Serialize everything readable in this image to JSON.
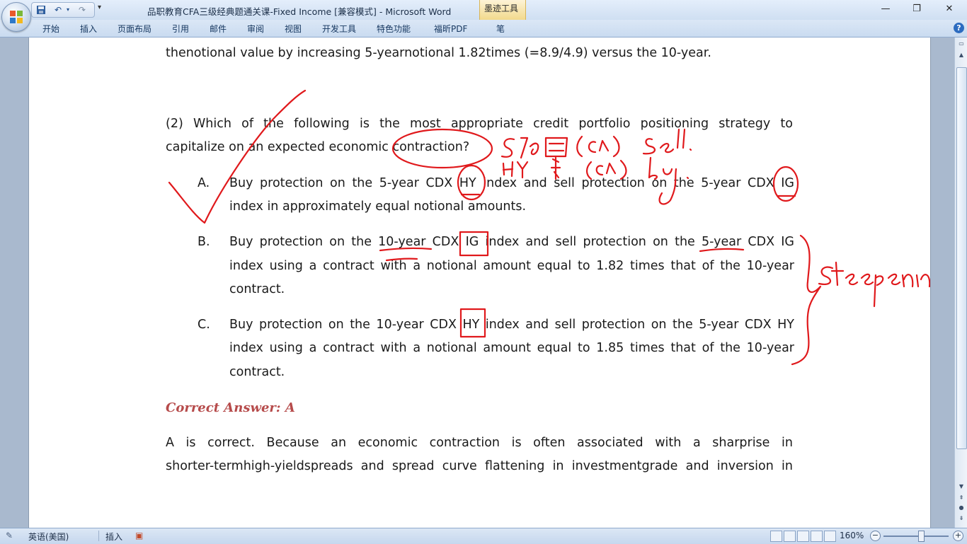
{
  "window": {
    "title": "品职教育CFA三级经典题通关课-Fixed Income [兼容模式] - Microsoft Word",
    "contextual_tab": "墨迹工具",
    "controls": {
      "minimize": "—",
      "restore": "❐",
      "close": "✕"
    }
  },
  "quick_access": {
    "save_icon": "floppy-disk",
    "undo_icon": "undo-arrow",
    "redo_icon": "redo-arrow",
    "more": "▾"
  },
  "ribbon": {
    "tabs": [
      {
        "label": "开始"
      },
      {
        "label": "插入"
      },
      {
        "label": "页面布局"
      },
      {
        "label": "引用"
      },
      {
        "label": "邮件"
      },
      {
        "label": "审阅"
      },
      {
        "label": "视图"
      },
      {
        "label": "开发工具"
      },
      {
        "label": "特色功能"
      },
      {
        "label": "福昕PDF"
      },
      {
        "label": "笔"
      }
    ],
    "help": "?"
  },
  "document": {
    "top_line": "thenotional value by increasing 5-yearnotional 1.82times (=8.9/4.9) versus the 10-year.",
    "question_line1": "(2) Which of the following is the most appropriate credit portfolio positioning strategy to",
    "question_line2": "capitalize on an expected economic contraction?",
    "options": [
      {
        "letter": "A.",
        "line1": "Buy protection on the 5-year CDX HY index and sell protection on the 5-year CDX IG",
        "line2": "index in approximately equal notional amounts.",
        "line3": ""
      },
      {
        "letter": "B.",
        "line1": "Buy protection on the 10-year CDX IG index and sell protection on the 5-year CDX IG",
        "line2": "index using a contract with a notional amount equal to 1.82 times that of the 10-year",
        "line3": "contract."
      },
      {
        "letter": "C.",
        "line1": "Buy protection on the 10-year CDX HY index and sell protection on the 5-year CDX HY",
        "line2": "index using a contract with a notional amount equal to 1.85 times that of the 10-year",
        "line3": "contract."
      }
    ],
    "answer_heading": "Correct Answer: A",
    "explanation_line1": "A is correct. Because an economic contraction is often associated with a sharprise in",
    "explanation_line2": "shorter-termhigh-yieldspreads and spread curve flattening in investmentgrade and inversion in"
  },
  "ink_annotations": {
    "color": "#e0191c",
    "handwritten_note_line1": "5Y IG (CR) sell.",
    "handwritten_note_line2": "HY 头 (CR) buy.",
    "side_note": "steepening"
  },
  "status_bar": {
    "language": "英语(美国)",
    "insert_mode": "插入",
    "zoom_percent": "160%",
    "zoom_minus": "−",
    "zoom_plus": "+",
    "zoom_level": 160
  }
}
